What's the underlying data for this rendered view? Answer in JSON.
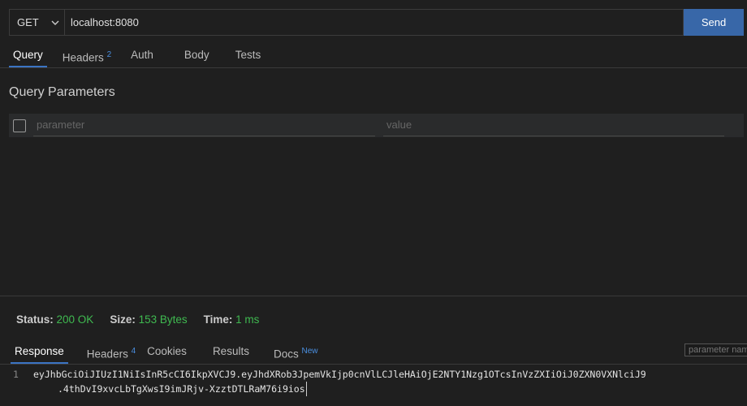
{
  "request": {
    "method": "GET",
    "url": "localhost:8080",
    "send_label": "Send",
    "tabs": [
      {
        "label": "Query",
        "active": true
      },
      {
        "label": "Headers",
        "badge": "2"
      },
      {
        "label": "Auth"
      },
      {
        "label": "Body"
      },
      {
        "label": "Tests"
      }
    ]
  },
  "query": {
    "title": "Query Parameters",
    "param_placeholder": "parameter",
    "value_placeholder": "value"
  },
  "response": {
    "status_label": "Status:",
    "status_value": "200 OK",
    "size_label": "Size:",
    "size_value": "153 Bytes",
    "time_label": "Time:",
    "time_value": "1 ms",
    "tabs": [
      {
        "label": "Response",
        "active": true
      },
      {
        "label": "Headers",
        "badge": "4"
      },
      {
        "label": "Cookies"
      },
      {
        "label": "Results"
      },
      {
        "label": "Docs",
        "badge": "New"
      }
    ],
    "filter_placeholder": "parameter name",
    "line_number": "1",
    "body_line1": "eyJhbGciOiJIUzI1NiIsInR5cCI6IkpXVCJ9.eyJhdXRob3JpemVkIjp0cnVlLCJleHAiOjE2NTY1Nzg1OTcsInVzZXIiOiJ0ZXN0VXNlciJ9",
    "body_line2": ".4thDvI9xvcLbTgXwsI9imJRjv-XzztDTLRaM76i9ios"
  },
  "colors": {
    "accent": "#3867a8",
    "success": "#3fb950",
    "badge": "#4a8fe0"
  }
}
